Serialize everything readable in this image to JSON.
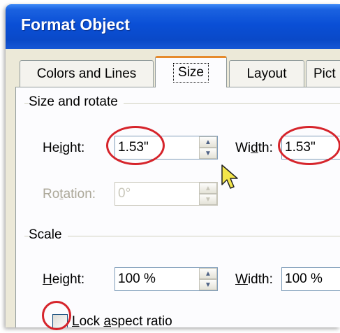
{
  "window": {
    "title": "Format Object"
  },
  "tabs": [
    {
      "label": "Colors and Lines"
    },
    {
      "label": "Size"
    },
    {
      "label": "Layout"
    },
    {
      "label": "Pict"
    }
  ],
  "size_rotate": {
    "group_title": "Size and rotate",
    "height_label": "Height:",
    "height_value": "1.53\"",
    "width_label": "Width:",
    "width_value": "1.53\"",
    "rotation_label": "Rotation:",
    "rotation_value": "0°"
  },
  "scale": {
    "group_title": "Scale",
    "height_label": "Height:",
    "height_value": "100 %",
    "width_label": "Width:",
    "width_value": "100 %"
  },
  "lock_aspect": {
    "label": "Lock aspect ratio",
    "checked": false
  },
  "colors": {
    "title_bar": "#0a4fd6",
    "annotation_circle": "#d6242b",
    "dialog_bg": "#ece9d8"
  }
}
